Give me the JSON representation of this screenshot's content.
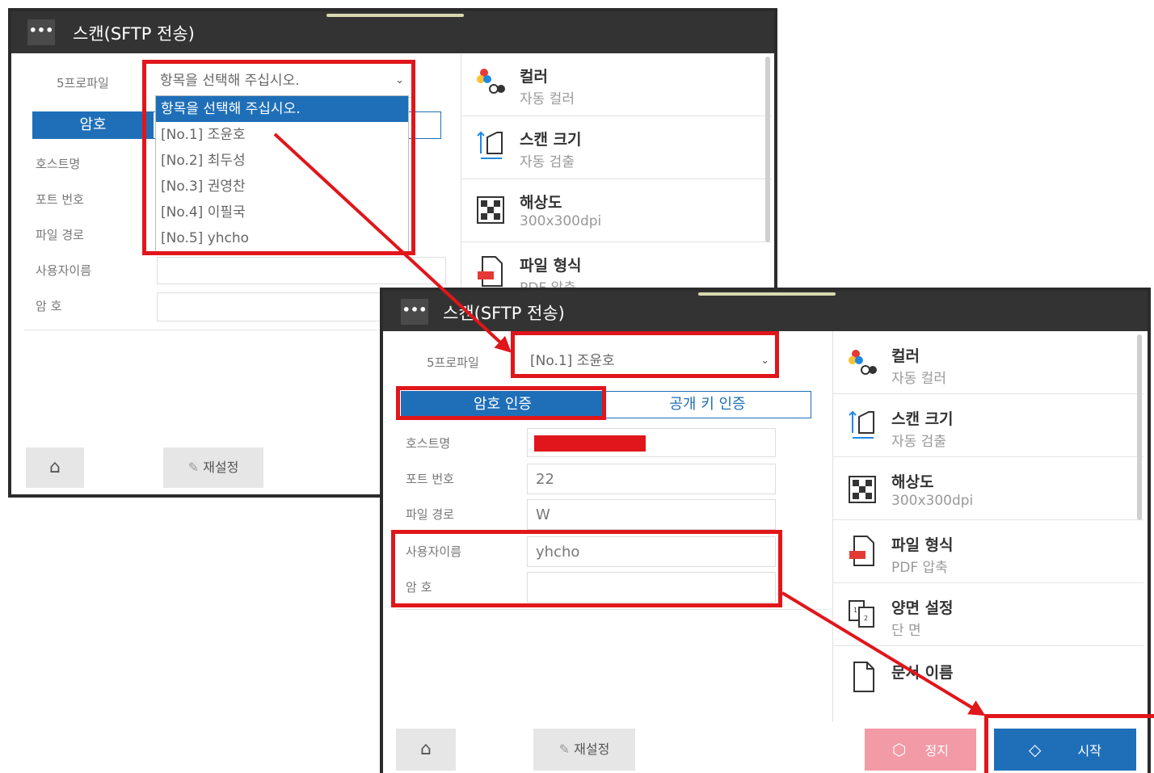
{
  "app": {
    "menu_icon": "ellipsis-icon",
    "menu_glyph": "•••",
    "title": "스캔(SFTP 전송)"
  },
  "profile": {
    "label": "5프로파일",
    "placeholder": "항목을 선택해 주십시오.",
    "selected": "[No.1] 조윤호",
    "options": [
      "항목을 선택해 주십시오.",
      "[No.1] 조윤호",
      "[No.2] 최두성",
      "[No.3] 권영찬",
      "[No.4] 이필국",
      "[No.5] yhcho"
    ]
  },
  "auth_tabs": {
    "password": "암호 인증",
    "public_key": "공개 키 인증",
    "password_short": "암호"
  },
  "form": {
    "host_label": "호스트명",
    "port_label": "포트 번호",
    "path_label": "파일 경로",
    "user_label": "사용자이름",
    "password_label": "암 호",
    "port_value": "22",
    "path_value": "W",
    "user_value": "yhcho"
  },
  "settings": [
    {
      "icon": "color-icon",
      "title": "컬러",
      "value": "자동 컬러"
    },
    {
      "icon": "scan-size-icon",
      "title": "스캔 크기",
      "value": "자동 검출"
    },
    {
      "icon": "resolution-icon",
      "title": "해상도",
      "value": "300x300dpi"
    },
    {
      "icon": "file-format-icon",
      "title": "파일 형식",
      "value": "PDF 압축"
    },
    {
      "icon": "duplex-icon",
      "title": "양면 설정",
      "value": "단 면"
    },
    {
      "icon": "document-icon",
      "title": "문서 이름",
      "value": ""
    }
  ],
  "first_window_file_format_value": "PDF 압축",
  "buttons": {
    "home_icon": "home-icon",
    "reset": "재설정",
    "stop": "정지",
    "start": "시작"
  },
  "colors": {
    "titlebar": "#333333",
    "accent_blue": "#1f6fb8",
    "highlight_red": "#e0161b",
    "stop_pink": "#f29aa6"
  }
}
